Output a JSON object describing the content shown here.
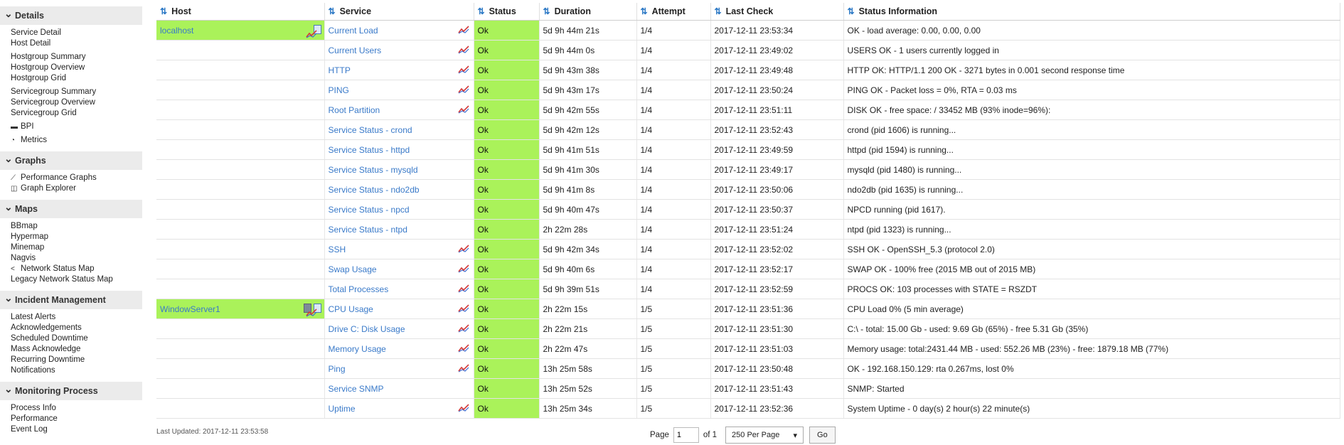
{
  "sidebar": {
    "sections": [
      {
        "title": "Details",
        "items": [
          {
            "label": "Service Detail"
          },
          {
            "label": "Host Detail"
          },
          {
            "gap": true
          },
          {
            "label": "Hostgroup Summary"
          },
          {
            "label": "Hostgroup Overview"
          },
          {
            "label": "Hostgroup Grid"
          },
          {
            "gap": true
          },
          {
            "label": "Servicegroup Summary"
          },
          {
            "label": "Servicegroup Overview"
          },
          {
            "label": "Servicegroup Grid"
          },
          {
            "gap": true
          },
          {
            "label": "BPI",
            "icon": "briefcase-icon",
            "glyph": "▬"
          },
          {
            "gap": true
          },
          {
            "label": "Metrics",
            "icon": "dashboard-icon",
            "glyph": "◔"
          }
        ]
      },
      {
        "title": "Graphs",
        "items": [
          {
            "label": "Performance Graphs",
            "icon": "line-chart-icon",
            "glyph": "⟋"
          },
          {
            "label": "Graph Explorer",
            "icon": "map-icon",
            "glyph": "◫"
          }
        ]
      },
      {
        "title": "Maps",
        "items": [
          {
            "label": "BBmap"
          },
          {
            "label": "Hypermap"
          },
          {
            "label": "Minemap"
          },
          {
            "label": "Nagvis"
          },
          {
            "label": "Network Status Map",
            "icon": "share-icon",
            "glyph": "<"
          },
          {
            "label": "Legacy Network Status Map"
          }
        ]
      },
      {
        "title": "Incident Management",
        "items": [
          {
            "label": "Latest Alerts"
          },
          {
            "label": "Acknowledgements"
          },
          {
            "label": "Scheduled Downtime"
          },
          {
            "label": "Mass Acknowledge"
          },
          {
            "label": "Recurring Downtime"
          },
          {
            "label": "Notifications"
          }
        ]
      },
      {
        "title": "Monitoring Process",
        "items": [
          {
            "label": "Process Info"
          },
          {
            "label": "Performance"
          },
          {
            "label": "Event Log"
          }
        ]
      }
    ]
  },
  "table": {
    "columns": [
      "Host",
      "Service",
      "Status",
      "Duration",
      "Attempt",
      "Last Check",
      "Status Information"
    ],
    "rows": [
      {
        "host": "localhost",
        "host_icons": [
          "doc",
          "perf"
        ],
        "service": "Current Load",
        "perf": true,
        "status": "Ok",
        "duration": "5d 9h 44m 21s",
        "attempt": "1/4",
        "last_check": "2017-12-11 23:53:34",
        "info": "OK - load average: 0.00, 0.00, 0.00"
      },
      {
        "host": "",
        "service": "Current Users",
        "perf": true,
        "status": "Ok",
        "duration": "5d 9h 44m 0s",
        "attempt": "1/4",
        "last_check": "2017-12-11 23:49:02",
        "info": "USERS OK - 1 users currently logged in"
      },
      {
        "host": "",
        "service": "HTTP",
        "perf": true,
        "status": "Ok",
        "duration": "5d 9h 43m 38s",
        "attempt": "1/4",
        "last_check": "2017-12-11 23:49:48",
        "info": "HTTP OK: HTTP/1.1 200 OK - 3271 bytes in 0.001 second response time"
      },
      {
        "host": "",
        "service": "PING",
        "perf": true,
        "status": "Ok",
        "duration": "5d 9h 43m 17s",
        "attempt": "1/4",
        "last_check": "2017-12-11 23:50:24",
        "info": "PING OK - Packet loss = 0%, RTA = 0.03 ms"
      },
      {
        "host": "",
        "service": "Root Partition",
        "perf": true,
        "status": "Ok",
        "duration": "5d 9h 42m 55s",
        "attempt": "1/4",
        "last_check": "2017-12-11 23:51:11",
        "info": "DISK OK - free space: / 33452 MB (93% inode=96%):"
      },
      {
        "host": "",
        "service": "Service Status - crond",
        "perf": false,
        "status": "Ok",
        "duration": "5d 9h 42m 12s",
        "attempt": "1/4",
        "last_check": "2017-12-11 23:52:43",
        "info": "crond (pid 1606) is running..."
      },
      {
        "host": "",
        "service": "Service Status - httpd",
        "perf": false,
        "status": "Ok",
        "duration": "5d 9h 41m 51s",
        "attempt": "1/4",
        "last_check": "2017-12-11 23:49:59",
        "info": "httpd (pid 1594) is running..."
      },
      {
        "host": "",
        "service": "Service Status - mysqld",
        "perf": false,
        "status": "Ok",
        "duration": "5d 9h 41m 30s",
        "attempt": "1/4",
        "last_check": "2017-12-11 23:49:17",
        "info": "mysqld (pid 1480) is running..."
      },
      {
        "host": "",
        "service": "Service Status - ndo2db",
        "perf": false,
        "status": "Ok",
        "duration": "5d 9h 41m 8s",
        "attempt": "1/4",
        "last_check": "2017-12-11 23:50:06",
        "info": "ndo2db (pid 1635) is running..."
      },
      {
        "host": "",
        "service": "Service Status - npcd",
        "perf": false,
        "status": "Ok",
        "duration": "5d 9h 40m 47s",
        "attempt": "1/4",
        "last_check": "2017-12-11 23:50:37",
        "info": "NPCD running (pid 1617)."
      },
      {
        "host": "",
        "service": "Service Status - ntpd",
        "perf": false,
        "status": "Ok",
        "duration": "2h 22m 28s",
        "attempt": "1/4",
        "last_check": "2017-12-11 23:51:24",
        "info": "ntpd (pid 1323) is running..."
      },
      {
        "host": "",
        "service": "SSH",
        "perf": true,
        "status": "Ok",
        "duration": "5d 9h 42m 34s",
        "attempt": "1/4",
        "last_check": "2017-12-11 23:52:02",
        "info": "SSH OK - OpenSSH_5.3 (protocol 2.0)"
      },
      {
        "host": "",
        "service": "Swap Usage",
        "perf": true,
        "status": "Ok",
        "duration": "5d 9h 40m 6s",
        "attempt": "1/4",
        "last_check": "2017-12-11 23:52:17",
        "info": "SWAP OK - 100% free (2015 MB out of 2015 MB)"
      },
      {
        "host": "",
        "service": "Total Processes",
        "perf": true,
        "status": "Ok",
        "duration": "5d 9h 39m 51s",
        "attempt": "1/4",
        "last_check": "2017-12-11 23:52:59",
        "info": "PROCS OK: 103 processes with STATE = RSZDT"
      },
      {
        "host": "WindowServer1",
        "host_icons": [
          "server",
          "doc",
          "perf"
        ],
        "service": "CPU Usage",
        "perf": true,
        "status": "Ok",
        "duration": "2h 22m 15s",
        "attempt": "1/5",
        "last_check": "2017-12-11 23:51:36",
        "info": "CPU Load 0% (5 min average)"
      },
      {
        "host": "",
        "service": "Drive C: Disk Usage",
        "perf": true,
        "status": "Ok",
        "duration": "2h 22m 21s",
        "attempt": "1/5",
        "last_check": "2017-12-11 23:51:30",
        "info": "C:\\ - total: 15.00 Gb - used: 9.69 Gb (65%) - free 5.31 Gb (35%)"
      },
      {
        "host": "",
        "service": "Memory Usage",
        "perf": true,
        "status": "Ok",
        "duration": "2h 22m 47s",
        "attempt": "1/5",
        "last_check": "2017-12-11 23:51:03",
        "info": "Memory usage: total:2431.44 MB - used: 552.26 MB (23%) - free: 1879.18 MB (77%)"
      },
      {
        "host": "",
        "service": "Ping",
        "perf": true,
        "status": "Ok",
        "duration": "13h 25m 58s",
        "attempt": "1/5",
        "last_check": "2017-12-11 23:50:48",
        "info": "OK - 192.168.150.129: rta 0.267ms, lost 0%"
      },
      {
        "host": "",
        "service": "Service SNMP",
        "perf": false,
        "status": "Ok",
        "duration": "13h 25m 52s",
        "attempt": "1/5",
        "last_check": "2017-12-11 23:51:43",
        "info": "SNMP: Started"
      },
      {
        "host": "",
        "service": "Uptime",
        "perf": true,
        "status": "Ok",
        "duration": "13h 25m 34s",
        "attempt": "1/5",
        "last_check": "2017-12-11 23:52:36",
        "info": "System Uptime - 0 day(s) 2 hour(s) 22 minute(s)"
      }
    ]
  },
  "footer": {
    "last_updated": "Last Updated: 2017-12-11 23:53:58",
    "page_label": "Page",
    "page_value": "1",
    "of_label": "of 1",
    "per_page": "250 Per Page",
    "go_label": "Go"
  },
  "colors": {
    "ok_green": "#aaf25a",
    "link_blue": "#3a7ac9",
    "sort_blue": "#2b78c5"
  }
}
